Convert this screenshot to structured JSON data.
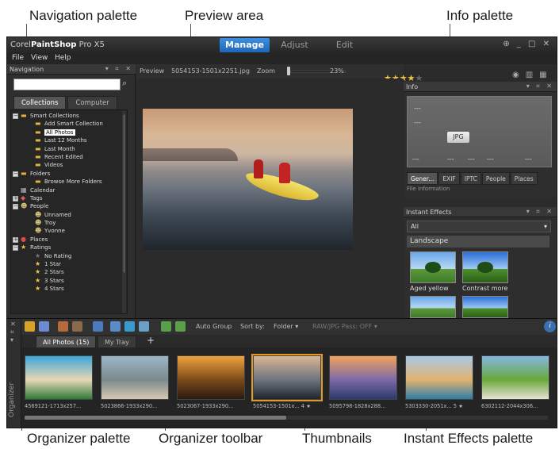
{
  "callouts": {
    "navigation": "Navigation palette",
    "preview": "Preview area",
    "info": "Info palette",
    "organizer": "Organizer palette",
    "organizer_toolbar": "Organizer toolbar",
    "thumbnails": "Thumbnails",
    "instant_effects": "Instant Effects palette"
  },
  "app": {
    "brand_prefix": "Corel",
    "brand_bold": "PaintShop",
    "brand_suffix": " Pro X5",
    "tabs": [
      "Manage",
      "Adjust",
      "Edit"
    ],
    "window_controls": "⊕ _ □ ✕",
    "menu": [
      "File",
      "View",
      "Help"
    ]
  },
  "navigation": {
    "title": "Navigation",
    "controls": "▾ ⌗ ✕",
    "search_placeholder": "",
    "tabs": [
      "Collections",
      "Computer"
    ],
    "tree": [
      {
        "label": "Smart Collections",
        "indent": 0,
        "expander": "−",
        "icon": "folder"
      },
      {
        "label": "Add Smart Collection",
        "indent": 1,
        "icon": "collection"
      },
      {
        "label": "All Photos",
        "indent": 1,
        "icon": "collection",
        "selected": true
      },
      {
        "label": "Last 12 Months",
        "indent": 1,
        "icon": "collection"
      },
      {
        "label": "Last Month",
        "indent": 1,
        "icon": "collection"
      },
      {
        "label": "Recent Edited",
        "indent": 1,
        "icon": "collection"
      },
      {
        "label": "Videos",
        "indent": 1,
        "icon": "collection"
      },
      {
        "label": "Folders",
        "indent": 0,
        "expander": "−",
        "icon": "folder"
      },
      {
        "label": "Browse More Folders",
        "indent": 1,
        "icon": "folder"
      },
      {
        "label": "Calendar",
        "indent": 0,
        "icon": "calendar"
      },
      {
        "label": "Tags",
        "indent": 0,
        "expander": "+",
        "icon": "tag"
      },
      {
        "label": "People",
        "indent": 0,
        "expander": "−",
        "icon": "person"
      },
      {
        "label": "Unnamed",
        "indent": 1,
        "icon": "person"
      },
      {
        "label": "Troy",
        "indent": 1,
        "icon": "person"
      },
      {
        "label": "Yvonne",
        "indent": 1,
        "icon": "person"
      },
      {
        "label": "Places",
        "indent": 0,
        "expander": "+",
        "icon": "pin"
      },
      {
        "label": "Ratings",
        "indent": 0,
        "expander": "−",
        "icon": "star"
      },
      {
        "label": "No Rating",
        "indent": 1,
        "icon": "star-dim"
      },
      {
        "label": "1 Star",
        "indent": 1,
        "icon": "star"
      },
      {
        "label": "2 Stars",
        "indent": 1,
        "icon": "star"
      },
      {
        "label": "3 Stars",
        "indent": 1,
        "icon": "star"
      },
      {
        "label": "4 Stars",
        "indent": 1,
        "icon": "star"
      }
    ]
  },
  "preview": {
    "label": "Preview",
    "filename": "5054153-1501x2251.jpg",
    "zoom_label": "Zoom",
    "zoom_value": "23%",
    "rating": 4,
    "rating_max": 5
  },
  "info": {
    "title": "Info",
    "controls": "▾ ⌗ ✕",
    "dash": "---",
    "format_badge": "JPG",
    "tabs": [
      "Gener...",
      "EXIF",
      "IPTC",
      "People",
      "Places"
    ],
    "sub_label": "File information"
  },
  "effects": {
    "title": "Instant Effects",
    "controls": "▾ ⌗ ✕",
    "select_value": "All",
    "group": "Landscape",
    "items": [
      "Aged yellow",
      "Contrast more"
    ]
  },
  "organizer": {
    "side_label": "Organizer",
    "auto_group": "Auto Group",
    "sort_by_label": "Sort by:",
    "sort_by_value": "Folder",
    "raw_pass": "RAW/JPG Pass: OFF",
    "tabs": [
      "All Photos (15)",
      "My Tray"
    ],
    "add_tab": "+",
    "info_button": "i",
    "thumbnails": [
      {
        "caption": "4569121-1713x257...",
        "colors": [
          "#3aa6d8",
          "#e7d8b3",
          "#2f7a3c"
        ]
      },
      {
        "caption": "5023866-1933x290...",
        "colors": [
          "#9db6c8",
          "#7b8a8d",
          "#d5c7b1"
        ]
      },
      {
        "caption": "5023067-1933x290...",
        "colors": [
          "#f0a33c",
          "#7c4a1a",
          "#2a1a10"
        ]
      },
      {
        "caption": "5054153-1501x... 4 ★",
        "colors": [
          "#d8b693",
          "#6e7580",
          "#1f252b"
        ],
        "selected": true
      },
      {
        "caption": "5095798-1828x288...",
        "colors": [
          "#f2a35c",
          "#7b6aa8",
          "#2c3a6a"
        ]
      },
      {
        "caption": "5303330-2051x... 5 ★",
        "colors": [
          "#a9c9e6",
          "#e2b36f",
          "#2c7da8"
        ]
      },
      {
        "caption": "6302112-2044x306...",
        "colors": [
          "#84b7e3",
          "#6aa83a",
          "#e8e2d6"
        ]
      }
    ]
  }
}
